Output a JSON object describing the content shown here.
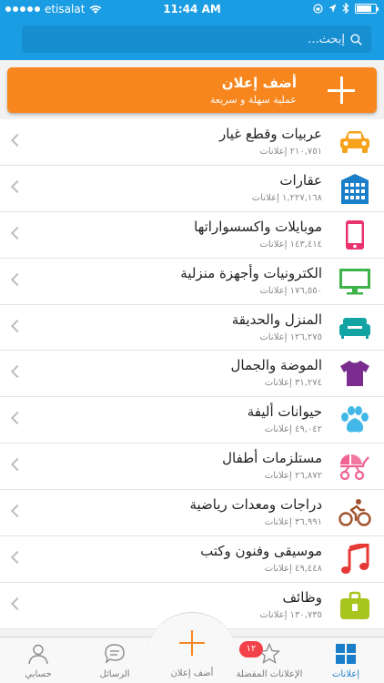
{
  "status_bar": {
    "carrier": "etisalat",
    "time": "11:44 AM"
  },
  "search": {
    "placeholder": "...إبحث"
  },
  "add_ad": {
    "title": "أضف إعلان",
    "subtitle": "عملية سهلة و سريعة"
  },
  "categories": [
    {
      "title": "عربيات وقطع غيار",
      "count": "٢١٠,٧٥١ إعلانات",
      "icon": "car-icon",
      "color": "#f7a21b"
    },
    {
      "title": "عقارات",
      "count": "١,٢٢٧,١٦٨ إعلانات",
      "icon": "building-icon",
      "color": "#1a7fc8"
    },
    {
      "title": "موبايلات واكسسواراتها",
      "count": "١٤٣,٤١٤ إعلانات",
      "icon": "mobile-phone-icon",
      "color": "#e8336d"
    },
    {
      "title": "الكترونيات وأجهزة منزلية",
      "count": "١٧٦,٥٥٠ إعلانات",
      "icon": "monitor-icon",
      "color": "#3db34a"
    },
    {
      "title": "المنزل والحديقة",
      "count": "١٢٦,٢٧٥ إعلانات",
      "icon": "sofa-icon",
      "color": "#14a3a3"
    },
    {
      "title": "الموضة والجمال",
      "count": "٣١,٢٧٤ إعلانات",
      "icon": "tshirt-icon",
      "color": "#7a2d8f"
    },
    {
      "title": "حيوانات أليفة",
      "count": "٤٩,٠٤٢ إعلانات",
      "icon": "paw-icon",
      "color": "#41b8e8"
    },
    {
      "title": "مستلزمات أطفال",
      "count": "٢٦,٨٧٢ إعلانات",
      "icon": "stroller-icon",
      "color": "#f06292"
    },
    {
      "title": "دراجات ومعدات رياضية",
      "count": "٣٦,٩٩١ إعلانات",
      "icon": "cyclist-icon",
      "color": "#a0522d"
    },
    {
      "title": "موسيقى وفنون وكتب",
      "count": "٤٩,٤٤٨ إعلانات",
      "icon": "music-note-icon",
      "color": "#e53935"
    },
    {
      "title": "وظائف",
      "count": "١٣٠,٧٣٥ إعلانات",
      "icon": "briefcase-icon",
      "color": "#a8c41e"
    }
  ],
  "tabbar": {
    "account": "حسابي",
    "messages": "الرسائل",
    "add_ad": "أضف إعلان",
    "favorites": "الإعلانات المفضلة",
    "favorites_badge": "١٢",
    "ads": "إعلانات"
  }
}
